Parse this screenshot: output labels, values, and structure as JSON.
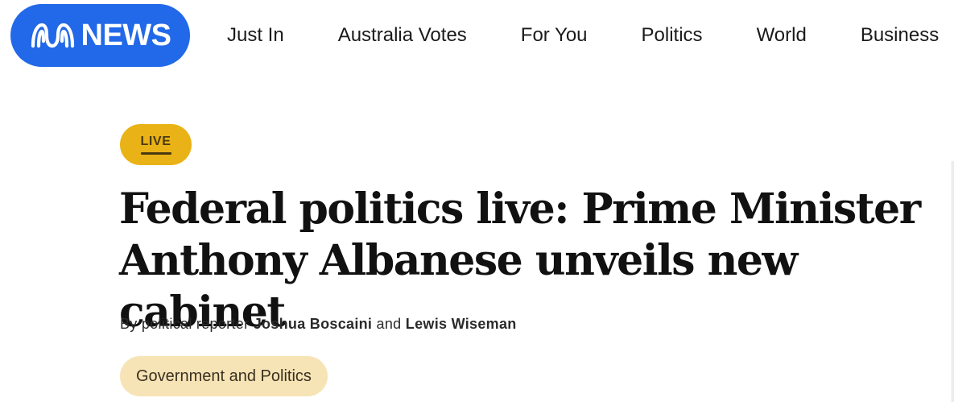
{
  "header": {
    "logo_text": "NEWS",
    "nav": [
      "Just In",
      "Australia Votes",
      "For You",
      "Politics",
      "World",
      "Business"
    ]
  },
  "article": {
    "live_label": "LIVE",
    "headline": "Federal politics live: Prime Minister Anthony Albanese unveils new cabinet",
    "byline_prefix": "By political reporter",
    "author1": "Joshua Boscaini",
    "byline_and": "and",
    "author2": "Lewis Wiseman",
    "topic": "Government and Politics"
  },
  "colors": {
    "brand_blue": "#2169e8",
    "live_yellow": "#e9b317",
    "tag_bg": "#f7e4b6"
  }
}
